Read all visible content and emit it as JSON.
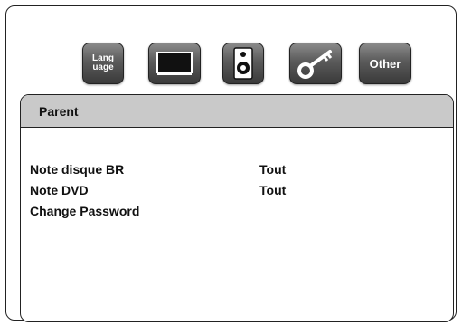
{
  "tabs": [
    {
      "name": "language",
      "label": "Lang\nuage"
    },
    {
      "name": "display",
      "icon": "display-icon"
    },
    {
      "name": "audio",
      "icon": "speaker-icon"
    },
    {
      "name": "parental",
      "icon": "key-icon"
    },
    {
      "name": "other",
      "label": "Other"
    }
  ],
  "panel": {
    "title": "Parent",
    "items": [
      {
        "label": "Note disque BR",
        "value": "Tout"
      },
      {
        "label": "Note DVD",
        "value": "Tout"
      },
      {
        "label": "Change Password",
        "value": ""
      }
    ]
  }
}
